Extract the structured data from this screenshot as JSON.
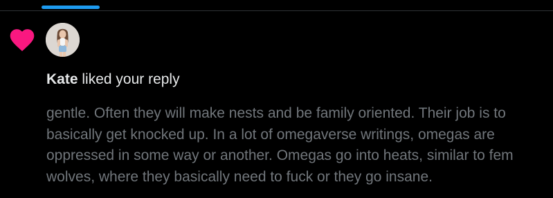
{
  "tabs": {
    "active_indicator_color": "#1d9bf0"
  },
  "notification": {
    "icon": "heart-icon",
    "icon_color": "#f91880",
    "avatar": "avatar",
    "user_name": "Kate",
    "action_text": " liked your reply",
    "reply_lines": [
      "gentle. Often they will make nests and be family oriented. Their job is to",
      "basically get knocked up. In a lot of omegaverse writings, omegas are",
      "oppressed in some way or another. Omegas go into heats, similar to fem",
      "wolves, where they basically need to fuck or they go insane."
    ]
  }
}
